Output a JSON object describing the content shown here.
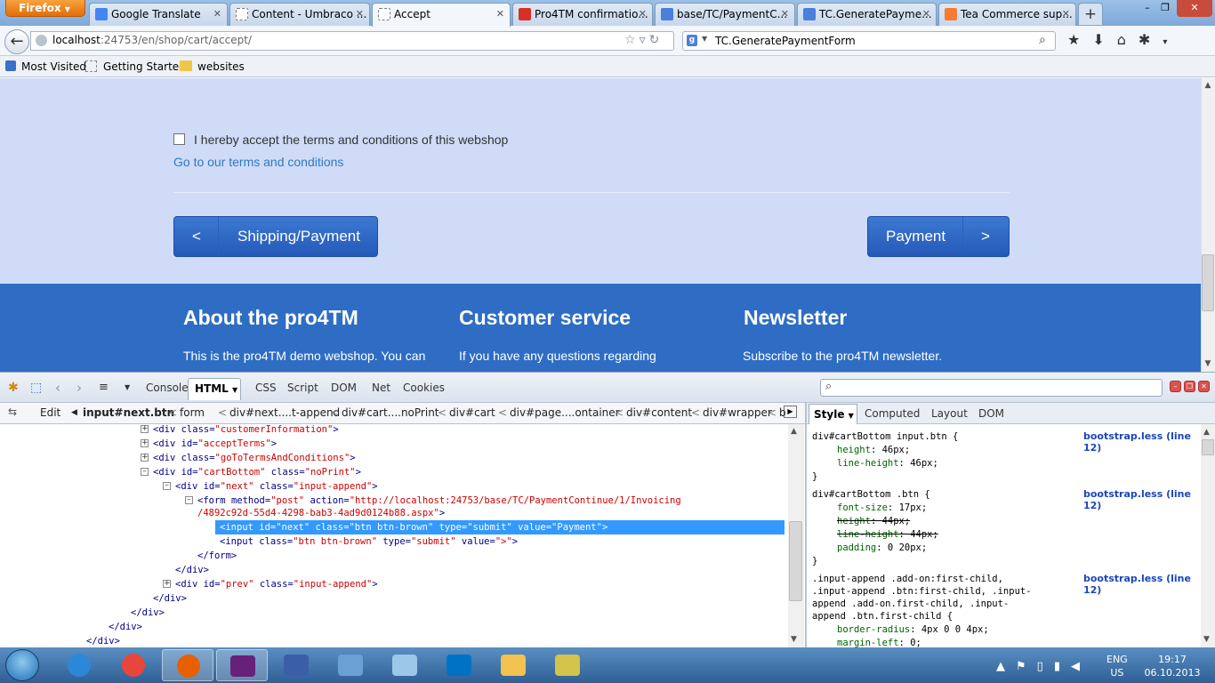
{
  "browser": {
    "menu_button": "Firefox",
    "tabs": [
      {
        "title": "Google Translate",
        "icon": "google-translate-icon",
        "color": "#4285f4"
      },
      {
        "title": "Content - Umbraco ...",
        "icon": "umbraco-icon",
        "color": "#ffffff"
      },
      {
        "title": "Accept",
        "icon": "loading-icon",
        "color": "#ffffff"
      },
      {
        "title": "Pro4TM confirmatio...",
        "icon": "gmail-icon",
        "color": "#d93025"
      },
      {
        "title": "base/TC/PaymentC...",
        "icon": "google-icon",
        "color": "#4a7fdb"
      },
      {
        "title": "TC.GeneratePayme...",
        "icon": "google-icon",
        "color": "#4a7fdb"
      },
      {
        "title": "Tea Commerce sup...",
        "icon": "teacommerce-icon",
        "color": "#f57c32"
      }
    ],
    "new_tab": "+",
    "window_controls": [
      "–",
      "❐",
      "✕"
    ],
    "url_host": "localhost",
    "url_rest": ":24753/en/shop/cart/accept/",
    "search_value": "TC.GeneratePaymentForm",
    "bookmarks": [
      "Most Visited",
      "Getting Started",
      "websites"
    ]
  },
  "page": {
    "accept_label": "I hereby accept the terms and conditions of this webshop",
    "terms_link": "Go to our terms and conditions",
    "prev_arrow": "<",
    "prev_label": "Shipping/Payment",
    "next_label": "Payment",
    "next_arrow": ">",
    "footer": [
      {
        "heading": "About the pro4TM",
        "text": "This is the pro4TM demo webshop. You can"
      },
      {
        "heading": "Customer service",
        "text": "If you have any questions regarding"
      },
      {
        "heading": "Newsletter",
        "text": "Subscribe to the pro4TM newsletter."
      }
    ]
  },
  "firebug": {
    "tabs": [
      "Console",
      "HTML",
      "CSS",
      "Script",
      "DOM",
      "Net",
      "Cookies"
    ],
    "active_tab": "HTML",
    "edit": "Edit",
    "breadcrumbs": [
      "input#next.btn",
      "form",
      "div#next....t-append",
      "div#cart....noPrint",
      "div#cart",
      "div#page....ontainer",
      "div#content",
      "div#wrapper",
      "b"
    ],
    "style_tabs": [
      "Style",
      "Computed",
      "Layout",
      "DOM"
    ],
    "html_lines": [
      {
        "indent": 0,
        "twisty": "+",
        "parts": [
          [
            "tg",
            "<div "
          ],
          [
            "at",
            "class="
          ],
          [
            "vl",
            "\"customerInformation\""
          ],
          [
            "tg",
            ">"
          ]
        ]
      },
      {
        "indent": 0,
        "twisty": "+",
        "parts": [
          [
            "tg",
            "<div "
          ],
          [
            "at",
            "id="
          ],
          [
            "vl",
            "\"acceptTerms\""
          ],
          [
            "tg",
            ">"
          ]
        ]
      },
      {
        "indent": 0,
        "twisty": "+",
        "parts": [
          [
            "tg",
            "<div "
          ],
          [
            "at",
            "class="
          ],
          [
            "vl",
            "\"goToTermsAndConditions\""
          ],
          [
            "tg",
            ">"
          ]
        ]
      },
      {
        "indent": 0,
        "twisty": "-",
        "parts": [
          [
            "tg",
            "<div "
          ],
          [
            "at",
            "id="
          ],
          [
            "vl",
            "\"cartBottom\""
          ],
          [
            "at",
            " class="
          ],
          [
            "vl",
            "\"noPrint\""
          ],
          [
            "tg",
            ">"
          ]
        ]
      },
      {
        "indent": 1,
        "twisty": "-",
        "parts": [
          [
            "tg",
            "<div "
          ],
          [
            "at",
            "id="
          ],
          [
            "vl",
            "\"next\""
          ],
          [
            "at",
            " class="
          ],
          [
            "vl",
            "\"input-append\""
          ],
          [
            "tg",
            ">"
          ]
        ]
      },
      {
        "indent": 2,
        "twisty": "-",
        "parts": [
          [
            "tg",
            "<form "
          ],
          [
            "at",
            "method="
          ],
          [
            "vl",
            "\"post\""
          ],
          [
            "at",
            " action="
          ],
          [
            "vl",
            "\"http://localhost:24753/base/TC/PaymentContinue/1/Invoicing"
          ]
        ]
      },
      {
        "indent": 2,
        "twisty": "",
        "parts": [
          [
            "vl",
            "/4892c92d-55d4-4298-bab3-4ad9d0124b88.aspx\""
          ],
          [
            "tg",
            ">"
          ]
        ]
      },
      {
        "indent": 3,
        "twisty": "",
        "selected": true,
        "parts": [
          [
            "tg",
            "<input "
          ],
          [
            "at",
            "id="
          ],
          [
            "vl",
            "\"next\""
          ],
          [
            "at",
            " class="
          ],
          [
            "vl",
            "\"btn btn-brown\""
          ],
          [
            "at",
            " type="
          ],
          [
            "vl",
            "\"submit\""
          ],
          [
            "at",
            " value="
          ],
          [
            "vl",
            "\"Payment\""
          ],
          [
            "tg",
            ">"
          ]
        ]
      },
      {
        "indent": 3,
        "twisty": "",
        "parts": [
          [
            "tg",
            "<input "
          ],
          [
            "at",
            "class="
          ],
          [
            "vl",
            "\"btn btn-brown\""
          ],
          [
            "at",
            " type="
          ],
          [
            "vl",
            "\"submit\""
          ],
          [
            "at",
            " value="
          ],
          [
            "vl",
            "\">\""
          ],
          [
            "tg",
            ">"
          ]
        ]
      },
      {
        "indent": 2,
        "twisty": "",
        "parts": [
          [
            "tg",
            "</form>"
          ]
        ]
      },
      {
        "indent": 1,
        "twisty": "",
        "parts": [
          [
            "tg",
            "</div>"
          ]
        ]
      },
      {
        "indent": 1,
        "twisty": "+",
        "parts": [
          [
            "tg",
            "<div "
          ],
          [
            "at",
            "id="
          ],
          [
            "vl",
            "\"prev\""
          ],
          [
            "at",
            " class="
          ],
          [
            "vl",
            "\"input-append\""
          ],
          [
            "tg",
            ">"
          ]
        ]
      },
      {
        "indent": 0,
        "twisty": "",
        "parts": [
          [
            "tg",
            "</div>"
          ]
        ]
      },
      {
        "indent": -1,
        "twisty": "",
        "parts": [
          [
            "tg",
            "</div>"
          ]
        ]
      },
      {
        "indent": -2,
        "twisty": "",
        "parts": [
          [
            "tg",
            "</div>"
          ]
        ]
      },
      {
        "indent": -3,
        "twisty": "",
        "parts": [
          [
            "tg",
            "</div>"
          ]
        ]
      }
    ],
    "style_rules": [
      {
        "selector": [
          "div#cartBottom input.btn {"
        ],
        "source": "bootstrap.less (line 12)",
        "props": [
          {
            "n": "height",
            "v": "46px;"
          },
          {
            "n": "line-height",
            "v": "46px;"
          }
        ]
      },
      {
        "selector": [
          "div#cartBottom .btn {"
        ],
        "source": "bootstrap.less (line 12)",
        "props": [
          {
            "n": "font-size",
            "v": "17px;"
          },
          {
            "n": "height",
            "v": "44px;",
            "strike": true
          },
          {
            "n": "line-height",
            "v": "44px;",
            "strike": true
          },
          {
            "n": "padding",
            "v": "0 20px;"
          }
        ]
      },
      {
        "selector": [
          ".input-append .add-on:first-child,",
          ".input-append .btn:first-child, .input-",
          "append .add-on.first-child, .input-",
          "append .btn.first-child {"
        ],
        "source": "bootstrap.less (line 12)",
        "props": [
          {
            "n": "border-radius",
            "v": "4px 0 0 4px;"
          },
          {
            "n": "margin-left",
            "v": "0;"
          }
        ]
      }
    ]
  },
  "taskbar": {
    "apps": [
      {
        "icon": "internet-explorer-icon",
        "color": "#2b88d8"
      },
      {
        "icon": "chrome-icon",
        "color": "#e8453c"
      },
      {
        "icon": "firefox-icon",
        "color": "#e66000",
        "active": true
      },
      {
        "icon": "visual-studio-icon",
        "color": "#68217a",
        "active": true
      },
      {
        "icon": "media-icon",
        "color": "#3a5fa8"
      },
      {
        "icon": "remote-desktop-icon",
        "color": "#6aa0d4"
      },
      {
        "icon": "notepad-icon",
        "color": "#9cc7e8"
      },
      {
        "icon": "outlook-icon",
        "color": "#0072c6"
      },
      {
        "icon": "explorer-icon",
        "color": "#f2c14e"
      },
      {
        "icon": "tools-icon",
        "color": "#d4c34a"
      }
    ],
    "lang_top": "ENG",
    "lang_bottom": "US",
    "time": "19:17",
    "date": "06.10.2013"
  }
}
